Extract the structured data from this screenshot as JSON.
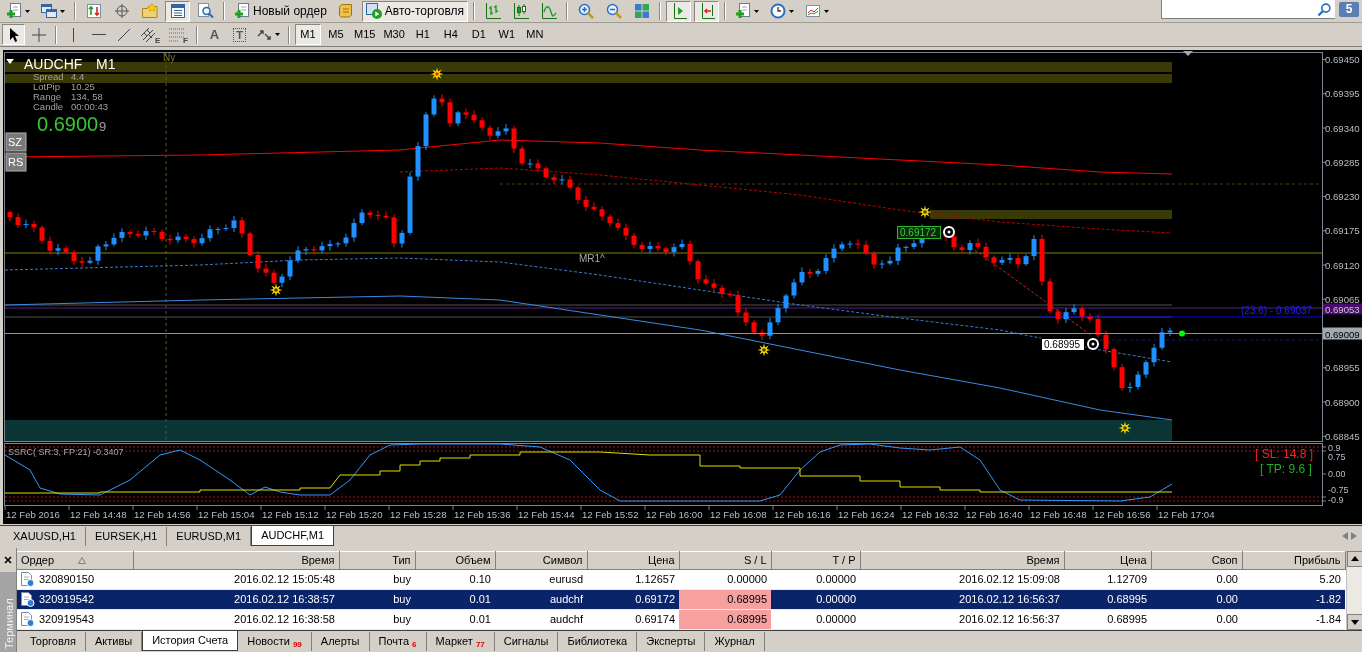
{
  "toolbar_main": {
    "groups": [
      [
        {
          "kind": "dropdown",
          "pressed": false
        },
        {
          "kind": "dropdown",
          "pressed": false
        }
      ],
      [
        {
          "kind": "icon",
          "pressed": false
        },
        {
          "kind": "icon",
          "pressed": false
        },
        {
          "kind": "icon",
          "pressed": false
        },
        {
          "kind": "icon",
          "pressed": true
        },
        {
          "kind": "icon",
          "pressed": false
        }
      ],
      [
        {
          "kind": "text",
          "label": "Новый ордер",
          "pressed": false
        },
        {
          "kind": "icon",
          "pressed": false
        },
        {
          "kind": "text",
          "label": "Авто-торговля",
          "pressed": true
        }
      ],
      [
        {
          "kind": "icon",
          "pressed": false
        },
        {
          "kind": "icon",
          "pressed": false
        },
        {
          "kind": "icon",
          "pressed": false
        }
      ],
      [
        {
          "kind": "icon",
          "pressed": false
        },
        {
          "kind": "icon",
          "pressed": false
        },
        {
          "kind": "icon",
          "pressed": false
        }
      ],
      [
        {
          "kind": "icon",
          "pressed": true
        },
        {
          "kind": "icon",
          "pressed": true
        }
      ],
      [
        {
          "kind": "dropdown",
          "pressed": false
        },
        {
          "kind": "dropdown",
          "pressed": false
        },
        {
          "kind": "dropdown",
          "pressed": false
        }
      ]
    ],
    "messages_count": "5"
  },
  "toolbar_tools": {
    "groups": [
      [
        {
          "kind": "icon",
          "selected": true
        },
        {
          "kind": "icon",
          "selected": false
        }
      ],
      [
        {
          "kind": "icon",
          "selected": false
        },
        {
          "kind": "icon",
          "selected": false
        },
        {
          "kind": "icon",
          "selected": false
        },
        {
          "kind": "icon",
          "letter": "E",
          "selected": false
        },
        {
          "kind": "icon",
          "letter": "F",
          "selected": false
        }
      ],
      [
        {
          "kind": "glyph",
          "label": "A",
          "selected": false
        },
        {
          "kind": "boxed_glyph",
          "label": "T",
          "selected": false
        },
        {
          "kind": "dropdown",
          "selected": false
        }
      ]
    ],
    "timeframes": [
      {
        "label": "M1",
        "selected": true
      },
      {
        "label": "M5",
        "selected": false
      },
      {
        "label": "M15",
        "selected": false
      },
      {
        "label": "M30",
        "selected": false
      },
      {
        "label": "H1",
        "selected": false
      },
      {
        "label": "H4",
        "selected": false
      },
      {
        "label": "D1",
        "selected": false
      },
      {
        "label": "W1",
        "selected": false
      },
      {
        "label": "MN",
        "selected": false
      }
    ]
  },
  "chart": {
    "symbol": "AUDCHF",
    "period": "M1",
    "session_label": "Ny",
    "info": [
      {
        "label": "Spread",
        "value": "4.4"
      },
      {
        "label": "LotPip",
        "value": "10.25"
      },
      {
        "label": "Range",
        "value": "134, 58"
      },
      {
        "label": "Candle",
        "value": "00:00:43"
      }
    ],
    "bid": "0.6900",
    "bid_last_digit": "9",
    "buttons": [
      "SZ",
      "RS"
    ],
    "level_label": "MR1^",
    "price_tags": [
      {
        "kind": "entry",
        "text": "0.69172"
      },
      {
        "kind": "stop",
        "text": "0.68995"
      }
    ],
    "fib_label": "(23.6) - 0.69037",
    "level_tag": "0.69053",
    "price_axis": [
      {
        "kind": "tick",
        "text": "0.69450"
      },
      {
        "kind": "tick",
        "text": "0.69395"
      },
      {
        "kind": "tick",
        "text": "0.69340"
      },
      {
        "kind": "tick",
        "text": "0.69285"
      },
      {
        "kind": "tick",
        "text": "0.69230"
      },
      {
        "kind": "tick",
        "text": "0.69175"
      },
      {
        "kind": "tick",
        "text": "0.69120"
      },
      {
        "kind": "tick",
        "text": "0.69065"
      },
      {
        "kind": "current",
        "text": "0.69009"
      },
      {
        "kind": "tick",
        "text": "0.68955"
      },
      {
        "kind": "tick",
        "text": "0.68900"
      },
      {
        "kind": "tick",
        "text": "0.68845"
      }
    ],
    "time_axis": [
      "12 Feb 2016",
      "12 Feb 14:48",
      "12 Feb 14:56",
      "12 Feb 15:04",
      "12 Feb 15:12",
      "12 Feb 15:20",
      "12 Feb 15:28",
      "12 Feb 15:36",
      "12 Feb 15:44",
      "12 Feb 15:52",
      "12 Feb 16:00",
      "12 Feb 16:08",
      "12 Feb 16:16",
      "12 Feb 16:24",
      "12 Feb 16:32",
      "12 Feb 16:40",
      "12 Feb 16:48",
      "12 Feb 16:56",
      "12 Feb 17:04"
    ]
  },
  "indicator": {
    "title": "SSRC( SR:3, FP:21) -0.3407",
    "stop_loss": "[ SL: 14.8 ]",
    "take_profit": "[ TP: 9.6 ]",
    "axis": [
      "0.9",
      "0.75",
      "0.00",
      "-0.75",
      "-0.9"
    ]
  },
  "chart_tabs": [
    {
      "label": "XAUUSD,H1",
      "selected": false
    },
    {
      "label": "EURSEK,H1",
      "selected": false
    },
    {
      "label": "EURUSD,M1",
      "selected": false
    },
    {
      "label": "AUDCHF,M1",
      "selected": true
    }
  ],
  "terminal": {
    "title": "Терминал",
    "columns": [
      {
        "label": "Ордер",
        "sorted": true
      },
      {
        "label": "Время",
        "sorted": false
      },
      {
        "label": "Тип",
        "sorted": false
      },
      {
        "label": "Объем",
        "sorted": false
      },
      {
        "label": "Символ",
        "sorted": false
      },
      {
        "label": "Цена",
        "sorted": false
      },
      {
        "label": "S / L",
        "sorted": false
      },
      {
        "label": "T / P",
        "sorted": false
      },
      {
        "label": "Время",
        "sorted": false
      },
      {
        "label": "Цена",
        "sorted": false
      },
      {
        "label": "Своп",
        "sorted": false
      },
      {
        "label": "Прибыль",
        "sorted": false
      }
    ],
    "rows": [
      {
        "cells": [
          "320890150",
          "2016.02.12 15:05:48",
          "buy",
          "0.10",
          "eurusd",
          "1.12657",
          "0.00000",
          "0.00000",
          "2016.02.12 15:09:08",
          "1.12709",
          "0.00",
          "5.20"
        ],
        "selected": false,
        "sl_hit": false
      },
      {
        "cells": [
          "320919542",
          "2016.02.12 16:38:57",
          "buy",
          "0.01",
          "audchf",
          "0.69172",
          "0.68995",
          "0.00000",
          "2016.02.12 16:56:37",
          "0.68995",
          "0.00",
          "-1.82"
        ],
        "selected": true,
        "sl_hit": true
      },
      {
        "cells": [
          "320919543",
          "2016.02.12 16:38:58",
          "buy",
          "0.01",
          "audchf",
          "0.69174",
          "0.68995",
          "0.00000",
          "2016.02.12 16:56:37",
          "0.68995",
          "0.00",
          "-1.84"
        ],
        "selected": false,
        "sl_hit": true
      }
    ],
    "tabs": [
      {
        "label": "Торговля",
        "selected": false
      },
      {
        "label": "Активы",
        "selected": false
      },
      {
        "label": "История Счета",
        "selected": true
      },
      {
        "label": "Новости",
        "count": "99",
        "selected": false
      },
      {
        "label": "Алерты",
        "selected": false
      },
      {
        "label": "Почта",
        "count": "6",
        "selected": false
      },
      {
        "label": "Маркет",
        "count": "77",
        "selected": false
      },
      {
        "label": "Сигналы",
        "selected": false
      },
      {
        "label": "Библиотека",
        "selected": false
      },
      {
        "label": "Эксперты",
        "selected": false
      },
      {
        "label": "Журнал",
        "selected": false
      }
    ]
  }
}
